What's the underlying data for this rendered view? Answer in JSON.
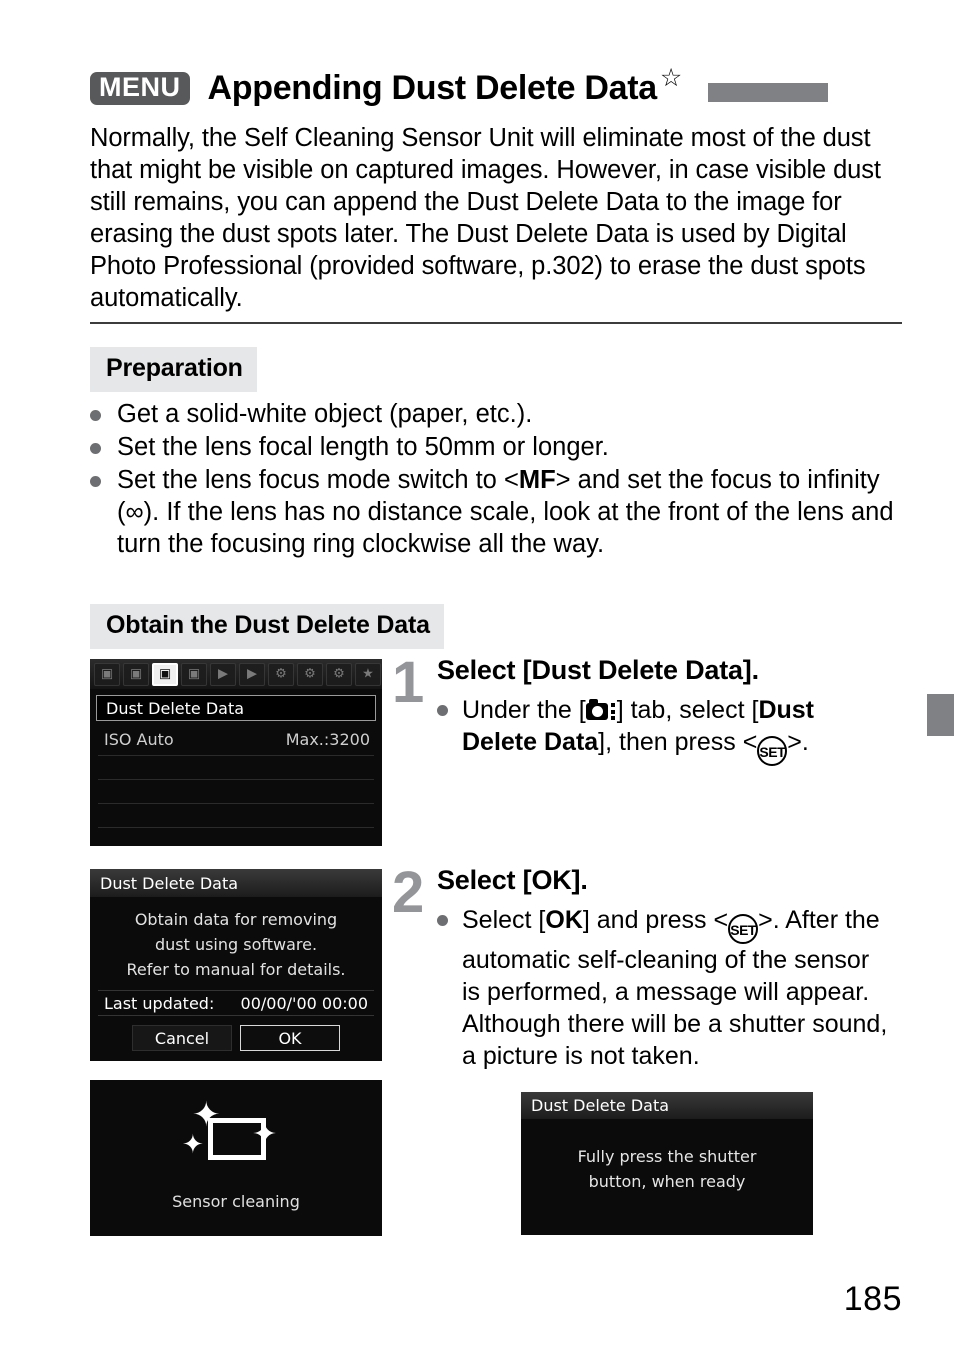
{
  "header": {
    "menu_badge": "MENU",
    "title": "Appending Dust Delete Data",
    "star": "☆"
  },
  "intro": {
    "paragraph": "Normally, the Self Cleaning Sensor Unit will eliminate most of the dust that might be visible on captured images. However, in case visible dust still remains, you can append the Dust Delete Data to the image for erasing the dust spots later. The Dust Delete Data is used by Digital Photo Professional (provided software, p.302) to erase the dust spots automatically."
  },
  "preparation": {
    "heading": "Preparation",
    "items": [
      {
        "text": "Get a solid-white object (paper, etc.)."
      },
      {
        "text": "Set the lens focal length to 50mm or longer."
      },
      {
        "text_part1": "Set the lens focus mode switch to <",
        "bold": "MF",
        "text_part2": "> and set the focus to infinity (∞). If the lens has no distance scale, look at the front of the lens and turn the focusing ring clockwise all the way."
      }
    ]
  },
  "obtain": {
    "heading": "Obtain the Dust Delete Data"
  },
  "steps": [
    {
      "number": "1",
      "title": "Select [Dust Delete Data].",
      "body_pre": "Under the [",
      "body_mid": "] tab, select [",
      "body_bold": "Dust Delete Data",
      "body_post": "], then press <",
      "body_end": ">.",
      "set_label": "SET"
    },
    {
      "number": "2",
      "title": "Select [OK].",
      "body_pre": "Select [",
      "body_bold": "OK",
      "body_post": "] and press <",
      "body_end": ">. After the automatic self-cleaning of the sensor is performed, a message will appear. Although there will be a shutter sound, a picture is not taken.",
      "set_label": "SET"
    }
  ],
  "lcd_menu": {
    "tabs": [
      {
        "name": "shooting-1",
        "glyph": "▣",
        "active": false
      },
      {
        "name": "shooting-2",
        "glyph": "▣",
        "active": false
      },
      {
        "name": "shooting-3",
        "glyph": "▣",
        "active": true
      },
      {
        "name": "shooting-4",
        "glyph": "▣",
        "active": false
      },
      {
        "name": "playback-1",
        "glyph": "▶",
        "active": false
      },
      {
        "name": "playback-2",
        "glyph": "▶",
        "active": false
      },
      {
        "name": "setup-1",
        "glyph": "⚙",
        "active": false
      },
      {
        "name": "setup-2",
        "glyph": "⚙",
        "active": false
      },
      {
        "name": "setup-3",
        "glyph": "⚙",
        "active": false
      },
      {
        "name": "my-menu",
        "glyph": "★",
        "active": false
      }
    ],
    "selected_row": "Dust Delete Data",
    "row2_label": "ISO Auto",
    "row2_value": "Max.:3200"
  },
  "lcd_dialog": {
    "title": "Dust Delete Data",
    "message_line1": "Obtain data for removing",
    "message_line2": "dust using software.",
    "message_line3": "Refer to manual for details.",
    "last_updated_label": "Last updated:",
    "last_updated_value": "00/00/'00 00:00",
    "cancel_label": "Cancel",
    "ok_label": "OK"
  },
  "lcd_clean": {
    "caption": "Sensor cleaning",
    "sparkle": "✦"
  },
  "lcd_ready": {
    "title": "Dust Delete Data",
    "message_line1": "Fully press the shutter",
    "message_line2": "button, when ready"
  },
  "folio": {
    "page_number": "185"
  },
  "colors": {
    "menu_badge_bg": "#58595b",
    "header_bar": "#808184",
    "section_bg": "#e6e7e8",
    "step_number": "#939598",
    "bullet_dot": "#6d6e71",
    "lcd_bg": "#0b0b0b"
  }
}
